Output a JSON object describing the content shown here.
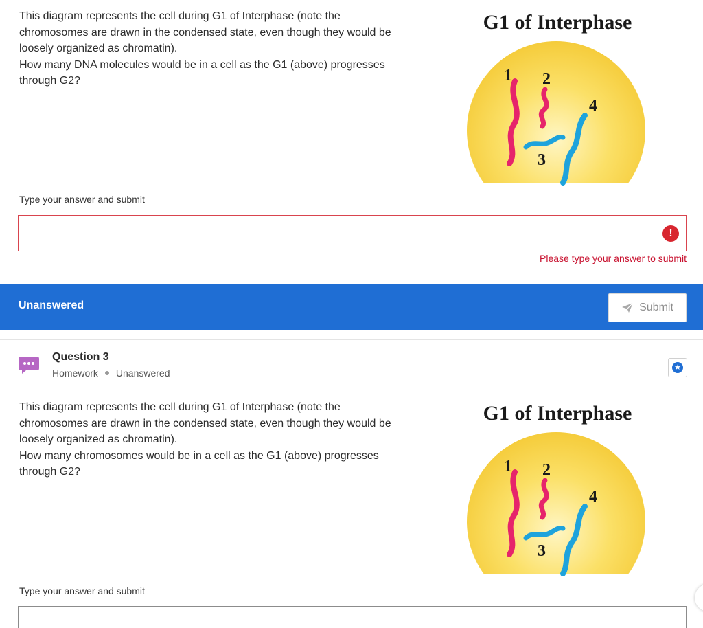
{
  "question_top": {
    "text_line1": "This diagram represents the cell during G1 of Interphase (note the chromosomes are drawn in the condensed state, even though they would be loosely organized as chromatin).",
    "text_line2": "How many DNA molecules would be in a cell as the G1 (above) progresses through G2?",
    "diagram_title": "G1 of Interphase",
    "chromosome_labels": [
      "1",
      "2",
      "3",
      "4"
    ],
    "answer_label": "Type your answer and submit",
    "answer_value": "",
    "error_icon_glyph": "!",
    "error_message": "Please type your answer to submit"
  },
  "status_bar": {
    "status": "Unanswered",
    "submit_label": "Submit"
  },
  "question_bottom": {
    "title": "Question 3",
    "meta_type": "Homework",
    "meta_status": "Unanswered",
    "text_line1": "This diagram represents the cell during G1 of Interphase (note the chromosomes are drawn in the condensed state, even though they would be loosely organized as chromatin).",
    "text_line2": "How many chromosomes would be in a cell as the G1 (above) progresses through G2?",
    "diagram_title": "G1 of Interphase",
    "chromosome_labels": [
      "1",
      "2",
      "3",
      "4"
    ],
    "answer_label": "Type your answer and submit",
    "answer_value": ""
  },
  "icons": {
    "question_icon": "chat-bubble-icon",
    "bookmark_icon": "star-icon",
    "error_icon": "exclamation-icon",
    "submit_icon": "send-icon",
    "bookmark_glyph": "★"
  },
  "colors": {
    "accent": "#1f6ed4",
    "error": "#d8262f",
    "cell_fill": "#fbe067",
    "chromosome_pink": "#e6246b",
    "chromosome_blue": "#1ea3dc",
    "question_icon": "#b667c4"
  }
}
